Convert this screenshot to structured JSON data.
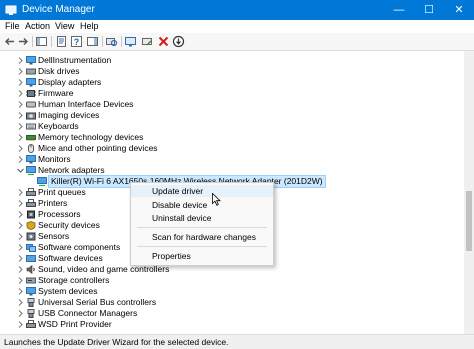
{
  "window": {
    "title": "Device Manager",
    "controls": {
      "minimize": "—",
      "maximize": "☐",
      "close": "✕"
    }
  },
  "menu": [
    "File",
    "Action",
    "View",
    "Help"
  ],
  "toolbar": {
    "buttons": [
      "back-icon",
      "forward-icon",
      "show-hide-console-tree-icon",
      "properties-icon",
      "help-icon",
      "show-hide-action-pane-icon",
      "scan-hardware-icon",
      "update-driver-icon",
      "uninstall-device-icon",
      "disable-device-icon"
    ]
  },
  "tree": {
    "items": [
      {
        "label": "DellInstrumentation",
        "icon": "monitor-icon"
      },
      {
        "label": "Disk drives",
        "icon": "disk-drive-icon"
      },
      {
        "label": "Display adapters",
        "icon": "display-adapter-icon"
      },
      {
        "label": "Firmware",
        "icon": "firmware-icon"
      },
      {
        "label": "Human Interface Devices",
        "icon": "hid-icon"
      },
      {
        "label": "Imaging devices",
        "icon": "camera-icon"
      },
      {
        "label": "Keyboards",
        "icon": "keyboard-icon"
      },
      {
        "label": "Memory technology devices",
        "icon": "memory-icon"
      },
      {
        "label": "Mice and other pointing devices",
        "icon": "mouse-icon"
      },
      {
        "label": "Monitors",
        "icon": "monitor-icon"
      },
      {
        "label": "Network adapters",
        "icon": "network-adapter-icon",
        "expanded": true
      },
      {
        "label": "Killer(R) Wi-Fi 6 AX1650s 160MHz Wireless Network Adapter (201D2W)",
        "icon": "network-adapter-icon",
        "child": true,
        "selected": true
      },
      {
        "label": "Print queues",
        "icon": "printer-icon"
      },
      {
        "label": "Printers",
        "icon": "printer-icon"
      },
      {
        "label": "Processors",
        "icon": "processor-icon"
      },
      {
        "label": "Security devices",
        "icon": "security-device-icon"
      },
      {
        "label": "Sensors",
        "icon": "sensor-icon"
      },
      {
        "label": "Software components",
        "icon": "software-component-icon"
      },
      {
        "label": "Software devices",
        "icon": "software-device-icon"
      },
      {
        "label": "Sound, video and game controllers",
        "icon": "sound-icon"
      },
      {
        "label": "Storage controllers",
        "icon": "storage-controller-icon"
      },
      {
        "label": "System devices",
        "icon": "system-device-icon"
      },
      {
        "label": "Universal Serial Bus controllers",
        "icon": "usb-icon"
      },
      {
        "label": "USB Connector Managers",
        "icon": "usb-icon"
      },
      {
        "label": "WSD Print Provider",
        "icon": "printer-icon"
      }
    ]
  },
  "context_menu": {
    "items": [
      "Update driver",
      "Disable device",
      "Uninstall device",
      "Scan for hardware changes",
      "Properties"
    ],
    "highlighted": "Update driver"
  },
  "status": "Launches the Update Driver Wizard for the selected device.",
  "colors": {
    "titlebar": "#0078d7",
    "selection": "#cce8ff",
    "menu_highlight": "#e5f1fb"
  }
}
